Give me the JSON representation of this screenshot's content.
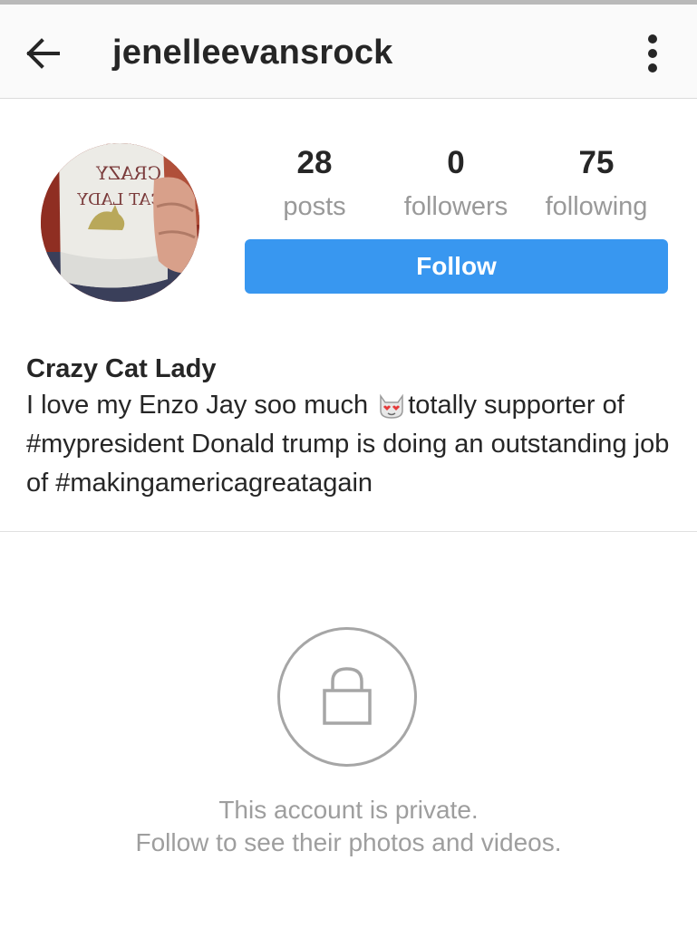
{
  "header": {
    "username": "jenelleevansrock",
    "back_icon": "arrow-left-icon",
    "menu_icon": "more-vertical-icon"
  },
  "profile": {
    "avatar_mug_text_line1": "CRAZY",
    "avatar_mug_text_line2": "CAT LADY",
    "stats": {
      "posts": {
        "value": "28",
        "label": "posts"
      },
      "followers": {
        "value": "0",
        "label": "followers"
      },
      "following": {
        "value": "75",
        "label": "following"
      }
    },
    "follow_label": "Follow",
    "name": "Crazy Cat Lady",
    "bio_part1": "I love my Enzo Jay soo much ",
    "bio_emoji": "heart-eyes-cat-icon",
    "bio_part2": "totally supporter of #mypresident Donald trump is doing an outstanding job of #makingamericagreatagain"
  },
  "private_notice": {
    "icon": "lock-icon",
    "title": "This account is private.",
    "subtitle": "Follow to see their photos and videos."
  },
  "colors": {
    "accent": "#3897f0",
    "text": "#262626",
    "muted": "#999999",
    "appbar": "#fafafa"
  }
}
